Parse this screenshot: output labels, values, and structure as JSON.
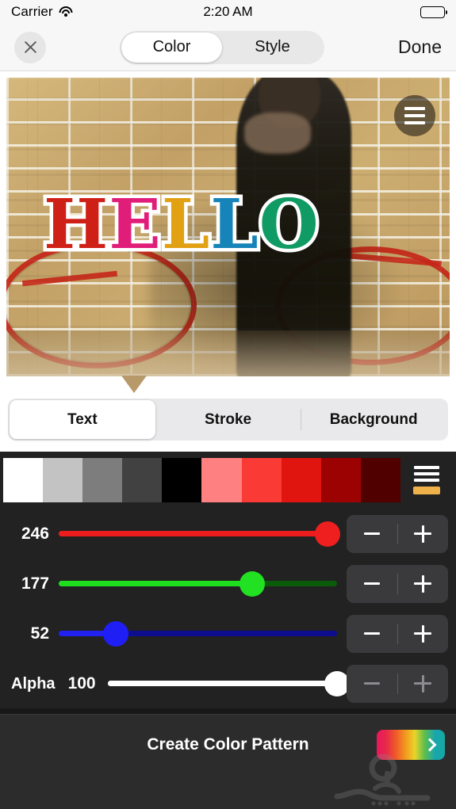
{
  "status_bar": {
    "carrier": "Carrier",
    "time": "2:20 AM",
    "wifi_icon": "wifi-icon",
    "battery_icon": "battery-full-icon"
  },
  "nav_bar": {
    "close_icon": "close-x-icon",
    "done_label": "Done",
    "tabs": [
      {
        "label": "Color",
        "active": true
      },
      {
        "label": "Style",
        "active": false
      }
    ]
  },
  "preview": {
    "overlay_text": "HELLO",
    "letters": [
      {
        "char": "H",
        "color": "#cf2017"
      },
      {
        "char": "E",
        "color": "#e01e7a"
      },
      {
        "char": "L",
        "color": "#e2a013"
      },
      {
        "char": "L",
        "color": "#1684b8"
      },
      {
        "char": "O",
        "color": "#0f9b63"
      }
    ],
    "stroke_color": "#ffffff",
    "menu_icon": "hamburger-menu-icon"
  },
  "target_tabs": [
    {
      "label": "Text",
      "active": true
    },
    {
      "label": "Stroke",
      "active": false
    },
    {
      "label": "Background",
      "active": false
    }
  ],
  "palette": {
    "swatches": [
      {
        "name": "white",
        "color": "#ffffff"
      },
      {
        "name": "light-gray",
        "color": "#c3c3c3"
      },
      {
        "name": "mid-gray",
        "color": "#7d7d7d"
      },
      {
        "name": "dark-gray",
        "color": "#414141"
      },
      {
        "name": "black",
        "color": "#000000"
      },
      {
        "name": "salmon",
        "color": "#ff8080"
      },
      {
        "name": "light-red",
        "color": "#fa3b35"
      },
      {
        "name": "red",
        "color": "#e01510"
      },
      {
        "name": "dark-red",
        "color": "#9d0202"
      },
      {
        "name": "darkest-red",
        "color": "#510000"
      }
    ],
    "menu_icon": "hamburger-menu-icon",
    "current_color_chip": "#efb14a"
  },
  "sliders": [
    {
      "name": "red",
      "label": "246",
      "value": 246,
      "max": 255,
      "percent": 96.5,
      "track_color": "#5c0000",
      "fill_color": "#ee1d1d",
      "knob_color": "#f01f1f",
      "stepper": {
        "minus": "−",
        "plus": "+",
        "disabled": false
      }
    },
    {
      "name": "green",
      "label": "177",
      "value": 177,
      "max": 255,
      "percent": 69.4,
      "track_color": "#0a5c0a",
      "fill_color": "#1ede1e",
      "knob_color": "#22e022",
      "stepper": {
        "minus": "−",
        "plus": "+",
        "disabled": false
      }
    },
    {
      "name": "blue",
      "label": "52",
      "value": 52,
      "max": 255,
      "percent": 20.4,
      "track_color": "#0d0d8e",
      "fill_color": "#2222f0",
      "knob_color": "#1f1ff5",
      "stepper": {
        "minus": "−",
        "plus": "+",
        "disabled": false
      }
    }
  ],
  "alpha": {
    "name": "alpha",
    "title": "Alpha",
    "label": "100",
    "value": 100,
    "max": 100,
    "percent": 100,
    "track_color": "#ffffff",
    "fill_color": "#ffffff",
    "knob_color": "#ffffff",
    "stepper": {
      "minus": "−",
      "plus": "+",
      "disabled": true
    }
  },
  "bottom_bar": {
    "create_label": "Create Color Pattern",
    "gradient_button_icon": "chevron-right-icon"
  }
}
